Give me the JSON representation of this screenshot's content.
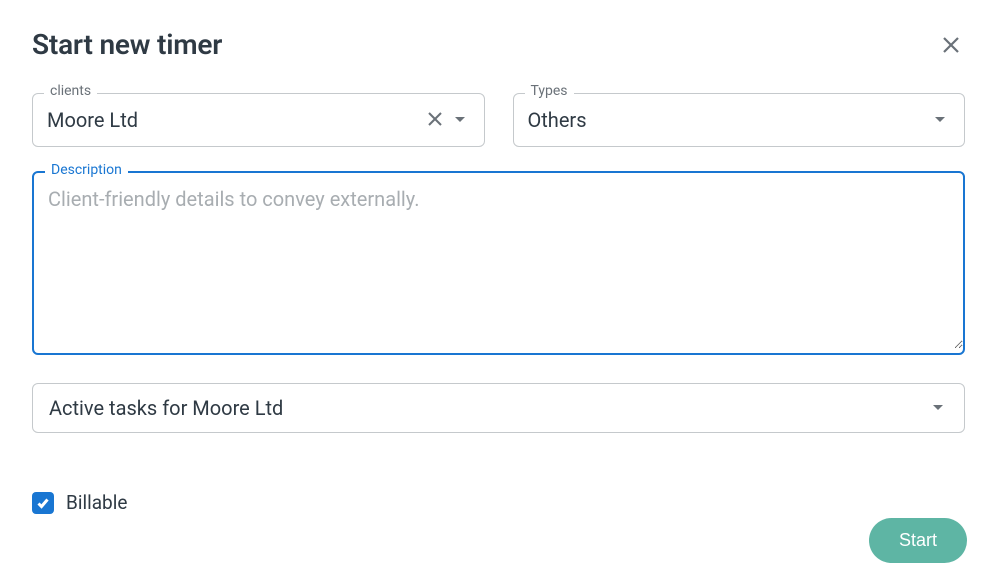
{
  "dialog": {
    "title": "Start new timer"
  },
  "fields": {
    "clients": {
      "label": "clients",
      "value": "Moore Ltd"
    },
    "types": {
      "label": "Types",
      "value": "Others"
    },
    "description": {
      "label": "Description",
      "placeholder": "Client-friendly details to convey externally.",
      "value": ""
    },
    "tasks": {
      "value": "Active tasks for Moore Ltd"
    }
  },
  "checkbox": {
    "billable_label": "Billable",
    "billable_checked": true
  },
  "buttons": {
    "start": "Start"
  }
}
